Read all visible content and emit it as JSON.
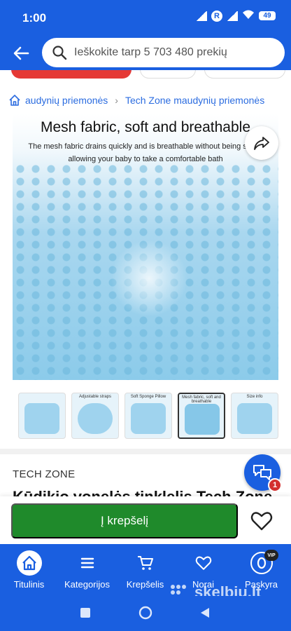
{
  "status": {
    "time": "1:00",
    "roaming": "R",
    "battery": "49"
  },
  "search": {
    "placeholder": "Ieškokite tarp 5 703 480 prekių"
  },
  "breadcrumb": {
    "items": [
      "audynių priemonės",
      "Tech Zone maudynių priemonės"
    ]
  },
  "gallery": {
    "title": "Mesh fabric, soft and breathable",
    "subtitle": "The mesh fabric drains quickly and is breathable without being stuffy, allowing your baby to take a comfortable bath"
  },
  "thumbnails": [
    {
      "label": "",
      "selected": false
    },
    {
      "label": "Adjustable straps",
      "selected": false
    },
    {
      "label": "Soft Sponge Pillow",
      "selected": false
    },
    {
      "label": "Mesh fabric, soft and breathable",
      "selected": true
    },
    {
      "label": "Size info",
      "selected": false
    }
  ],
  "product": {
    "brand": "TECH ZONE",
    "title": "Kūdikio vonelės tinklelis Tech Zone"
  },
  "chat": {
    "badge": "1"
  },
  "actions": {
    "add_to_cart": "Į krepšelį"
  },
  "nav": {
    "items": [
      {
        "label": "Titulinis",
        "icon": "home-icon",
        "active": true
      },
      {
        "label": "Kategorijos",
        "icon": "menu-icon",
        "active": false
      },
      {
        "label": "Krepšelis",
        "icon": "cart-icon",
        "active": false
      },
      {
        "label": "Norai",
        "icon": "heart-icon",
        "active": false
      },
      {
        "label": "Paskyra",
        "icon": "account-icon",
        "active": false
      }
    ],
    "vip": "VIP"
  },
  "watermark": "skelbiu.lt",
  "colors": {
    "primary": "#1a5fe0",
    "cart_button": "#1f8a2b",
    "badge": "#d32f2f",
    "link": "#2b6ce0"
  }
}
